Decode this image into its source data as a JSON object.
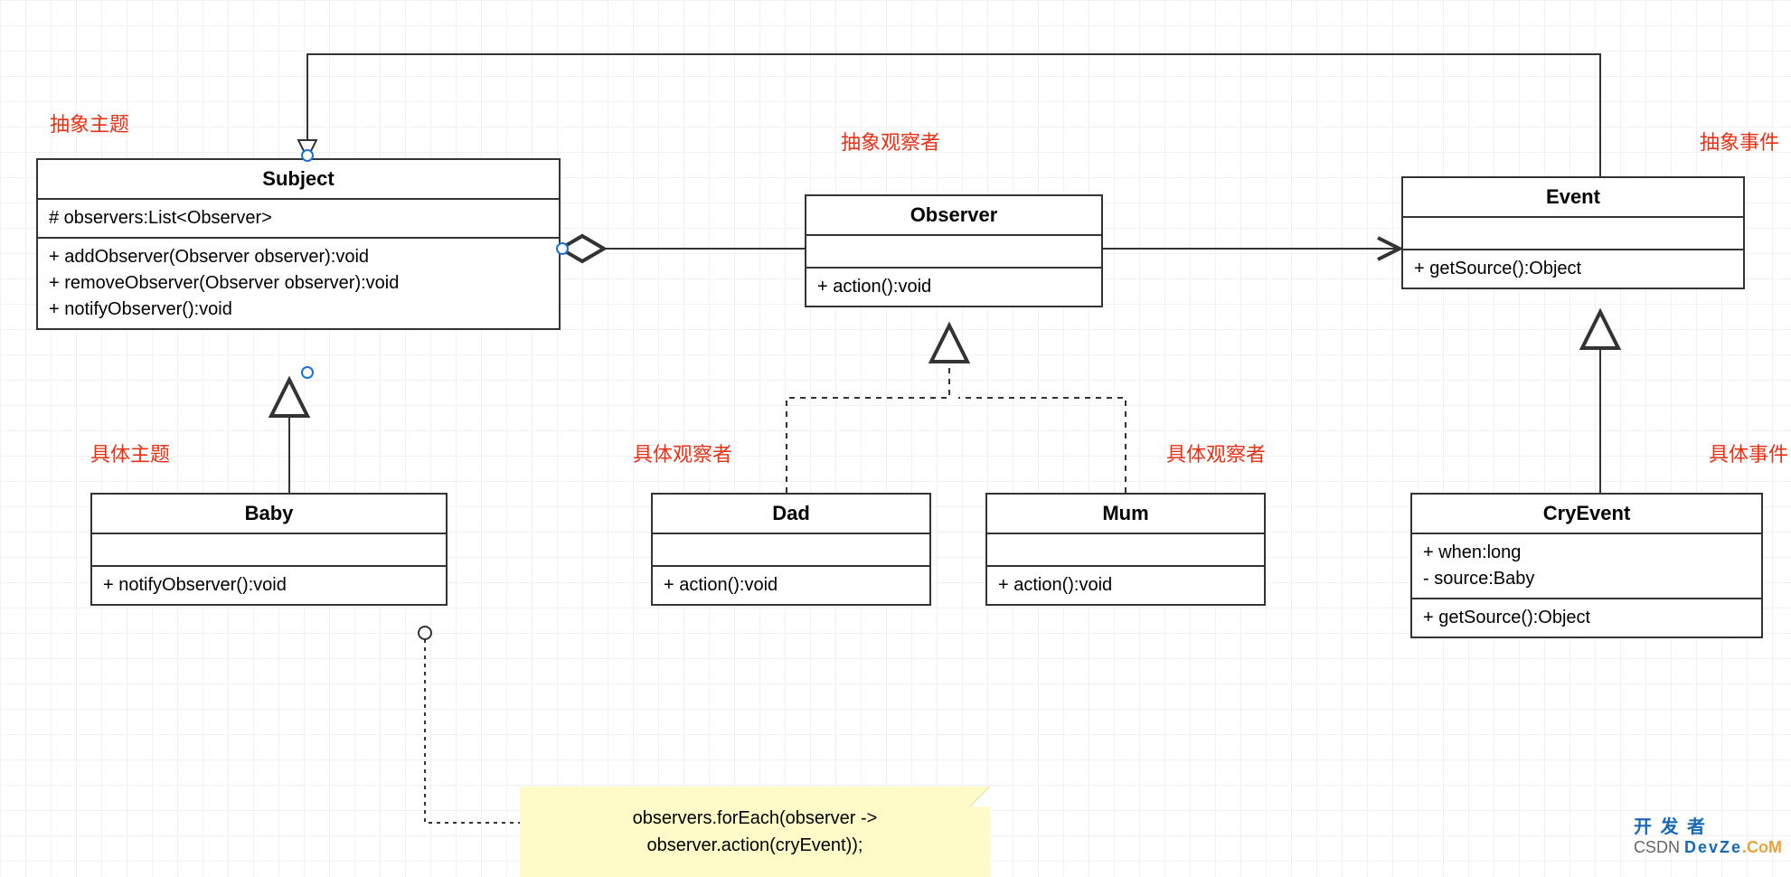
{
  "labels": {
    "abstractSubject": "抽象主题",
    "abstractObserver": "抽象观察者",
    "abstractEvent": "抽象事件",
    "concreteSubject": "具体主题",
    "concreteObserver1": "具体观察者",
    "concreteObserver2": "具体观察者",
    "concreteEvent": "具体事件"
  },
  "classes": {
    "subject": {
      "name": "Subject",
      "attrs": "# observers:List<Observer>",
      "ops": "+ addObserver(Observer observer):void\n+ removeObserver(Observer observer):void\n+ notifyObserver():void"
    },
    "observer": {
      "name": "Observer",
      "ops": "+ action():void"
    },
    "event": {
      "name": "Event",
      "ops": "+ getSource():Object"
    },
    "baby": {
      "name": "Baby",
      "ops": "+ notifyObserver():void"
    },
    "dad": {
      "name": "Dad",
      "ops": "+ action():void"
    },
    "mum": {
      "name": "Mum",
      "ops": "+ action():void"
    },
    "cryEvent": {
      "name": "CryEvent",
      "attrs": "+ when:long\n- source:Baby",
      "ops": "+ getSource():Object"
    }
  },
  "note": {
    "line1": "observers.forEach(observer ->",
    "line2": "observer.action(cryEvent));"
  },
  "watermark": {
    "csdn": "CSDN",
    "dev": "DevZe",
    "com": ".CoM",
    "kaifazhe": "开 发 者"
  }
}
